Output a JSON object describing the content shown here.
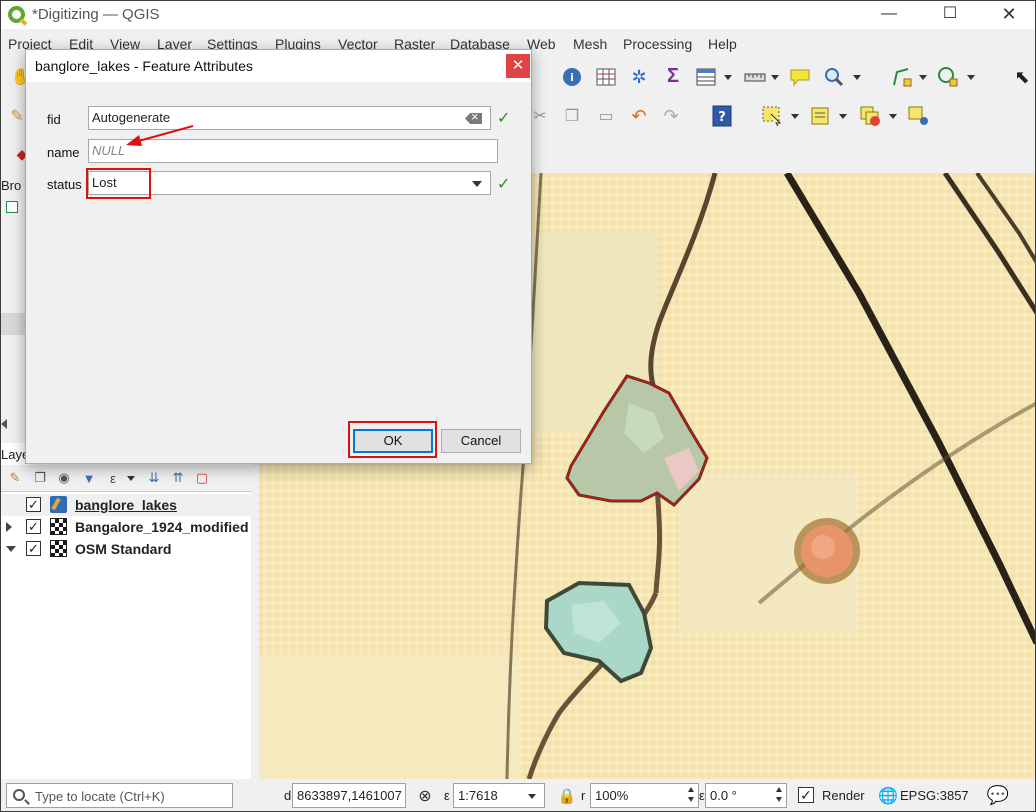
{
  "window": {
    "title": "*Digitizing — QGIS",
    "min_glyph": "—",
    "max_glyph": "☐",
    "close_glyph": "✕"
  },
  "menu": [
    "Project",
    "Edit",
    "View",
    "Layer",
    "Settings",
    "Plugins",
    "Vector",
    "Raster",
    "Database",
    "Web",
    "Mesh",
    "Processing",
    "Help"
  ],
  "side_fragments": {
    "browser": "Bro",
    "layers": "Laye"
  },
  "dialog": {
    "title": "banglore_lakes - Feature Attributes",
    "close_glyph": "✕",
    "fields": [
      {
        "label": "fid",
        "value": "Autogenerate",
        "placeholder": ""
      },
      {
        "label": "name",
        "value": "",
        "placeholder": "NULL"
      },
      {
        "label": "status",
        "value": "Lost",
        "placeholder": ""
      }
    ],
    "ok_label": "OK",
    "cancel_label": "Cancel"
  },
  "layers": [
    {
      "name": "banglore_lakes",
      "checked": true,
      "kind": "vector",
      "selected": true
    },
    {
      "name": "Bangalore_1924_modified",
      "checked": true,
      "kind": "raster",
      "expander": "right"
    },
    {
      "name": "OSM Standard",
      "checked": true,
      "kind": "raster",
      "expander": "down"
    }
  ],
  "checkmark": "✓",
  "status_bar": {
    "locate_placeholder": "Type to locate (Ctrl+K)",
    "coord_prefix": "d",
    "coordinate": "8633897,1461007",
    "scale_prefix": "ε",
    "scale": "1:7618",
    "magnifier_prefix": "r",
    "magnifier": "100%",
    "rotation_prefix": "ε",
    "rotation": "0.0 °",
    "render_label": "Render",
    "crs": "EPSG:3857"
  },
  "colors": {
    "annotation_red": "#e01010",
    "qgis_green": "#5fa833",
    "map_base": "#f6e6b4",
    "lake_fill": "#a9cfae",
    "selected_lake_outline": "#d01010"
  }
}
